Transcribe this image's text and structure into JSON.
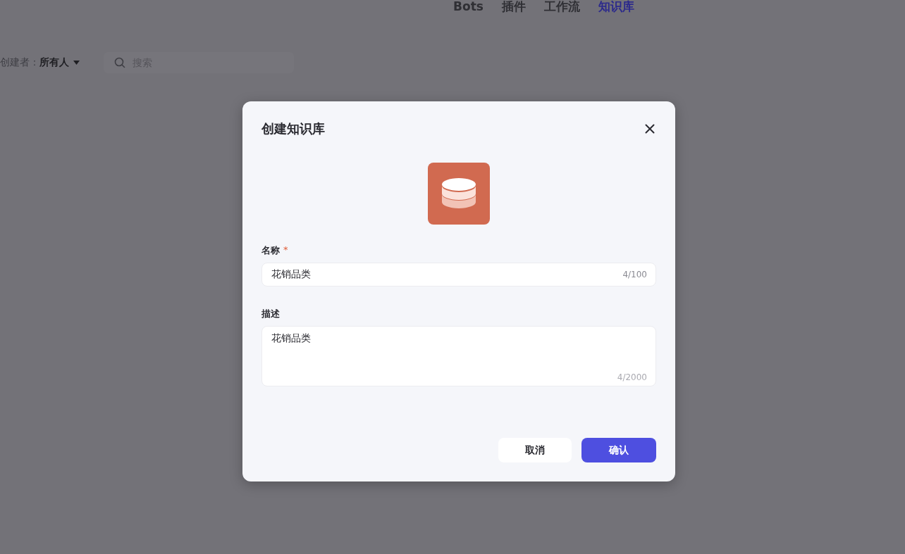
{
  "header": {
    "tabs": [
      {
        "label": "Bots",
        "selected": false
      },
      {
        "label": "插件",
        "selected": false
      },
      {
        "label": "工作流",
        "selected": false
      },
      {
        "label": "知识库",
        "selected": true
      }
    ]
  },
  "filters": {
    "creator_label": "创建者：",
    "creator_value": "所有人",
    "search": {
      "placeholder": "搜索"
    }
  },
  "dialog": {
    "title": "创建知识库",
    "fields": [
      {
        "kind": "input",
        "label": "名称",
        "required_mark": "*",
        "value": "花销品类",
        "counter": "4/100"
      },
      {
        "kind": "textarea",
        "label": "描述",
        "value": "花销品类",
        "counter": "4/2000"
      }
    ],
    "buttons": [
      {
        "label": "取消",
        "kind": "secondary"
      },
      {
        "label": "确认",
        "kind": "primary"
      }
    ]
  }
}
